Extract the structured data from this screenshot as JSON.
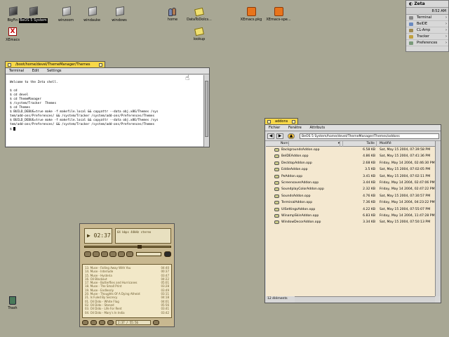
{
  "desktop": {
    "icons": [
      {
        "label": "BigFin",
        "kind": "cube-dark"
      },
      {
        "label": "BeOS 5 System",
        "kind": "cube-dark",
        "selected": true
      },
      {
        "label": "winzoom",
        "kind": "cube"
      },
      {
        "label": "windauke",
        "kind": "cube"
      },
      {
        "label": "windows",
        "kind": "cube"
      },
      {
        "label": "home",
        "kind": "people"
      },
      {
        "label": "DataToDoIcs...",
        "kind": "paper"
      },
      {
        "label": "XEmacs.pkg",
        "kind": "pkg"
      },
      {
        "label": "XEmacs-spe...",
        "kind": "pkg"
      },
      {
        "label": "XEmacs",
        "kind": "x"
      },
      {
        "label": "lookup",
        "kind": "paper"
      },
      {
        "label": "Trash",
        "kind": "trash"
      }
    ]
  },
  "deskbar": {
    "logo": "Zeta",
    "clock": "8:52 AM",
    "items": [
      {
        "label": "Terminal"
      },
      {
        "label": "BeIDE"
      },
      {
        "label": "CL-Amp"
      },
      {
        "label": "Tracker"
      },
      {
        "label": "Preferences"
      }
    ]
  },
  "terminal": {
    "title": "/boot/home/devel/ThemeManager/Themes",
    "menu": [
      "Terminal",
      "Edit",
      "Settings"
    ],
    "lines": [
      "",
      "Welcome to the Zeta shell.",
      "",
      "$ cd",
      "$ cd devel",
      "$ cd ThemeManager",
      "$ /system/Tracker  Themes",
      "$ cd Themes",
      "$ BUILD_DEBUG=true make -f makefile.local && copyattr --data obj.x86/Themes /sys",
      "tem/add-ons/Preferences/ && /system/Tracker /system/add-ons/Preferences/Themes",
      "$ BUILD_DEBUG=true make -f makefile.local && copyattr --data obj.x86/Themes /sys",
      "tem/add-ons/Preferences/ && /system/Tracker /system/add-ons/Preferences/Themes",
      "$ "
    ]
  },
  "addons": {
    "title": "addons",
    "menu": [
      "Fichier",
      "Fenêtre",
      "Attributs"
    ],
    "path": "BeOS 5 System/home/devel/ThemeManager/Themes/addons",
    "columns": {
      "name": "Nom",
      "size": "Taille",
      "modified": "Modifié"
    },
    "rows": [
      {
        "name": "BackgroundsAddon.opp",
        "size": "6.58 KB",
        "modified": "Sat, May 15 2004, 07:39:58 PM"
      },
      {
        "name": "BeIDEAddon.opp",
        "size": "4.86 KB",
        "modified": "Sat, May 15 2004, 07:41:36 PM"
      },
      {
        "name": "DecktopAddon.opp",
        "size": "2.68 KB",
        "modified": "Friday, May 14 2004, 02:46:30 PM"
      },
      {
        "name": "EddieAddon.opp",
        "size": "3.5 KB",
        "modified": "Sat, May 15 2004, 07:02:05 PM"
      },
      {
        "name": "PeAddon.opp",
        "size": "3.41 KB",
        "modified": "Sat, May 15 2004, 07:02:11 PM"
      },
      {
        "name": "ScreensaverAddon.opp",
        "size": "3.44 KB",
        "modified": "Friday, May 14 2004, 02:47:06 PM"
      },
      {
        "name": "SoundplayColorAddon.opp",
        "size": "2.32 KB",
        "modified": "Friday, May 14 2004, 02:47:22 PM"
      },
      {
        "name": "SoundsAddon.opp",
        "size": "4.76 KB",
        "modified": "Sat, May 15 2004, 07:30:57 PM"
      },
      {
        "name": "TerminalAddon.opp",
        "size": "7.36 KB",
        "modified": "Friday, May 14 2004, 04:23:22 PM"
      },
      {
        "name": "UISettingsAddon.opp",
        "size": "4.22 KB",
        "modified": "Sat, May 15 2004, 07:55:07 PM"
      },
      {
        "name": "WinampSkinAddon.opp",
        "size": "6.83 KB",
        "modified": "Friday, May 14 2004, 11:47:28 PM"
      },
      {
        "name": "WindowDecorAddon.opp",
        "size": "3.34 KB",
        "modified": "Sat, May 15 2004, 07:50:13 PM"
      }
    ],
    "status": "12 éléments"
  },
  "player": {
    "time": "02:37",
    "info": "64 kbps  44kHz  stereo",
    "playlist": [
      {
        "title": "13. Muse - Falling Away With You",
        "time": "04:40"
      },
      {
        "title": "14. Muse - Interlude",
        "time": "00:37"
      },
      {
        "title": "15. Muse - Hysteria",
        "time": "03:47"
      },
      {
        "title": "16. Oil Blackout",
        "time": "04:22"
      },
      {
        "title": "17. Muse - Butterflies and Hurricanes",
        "time": "05:01"
      },
      {
        "title": "18. Muse - The Small Print",
        "time": "03:28"
      },
      {
        "title": "19. Muse - Endlessly",
        "time": "03:49"
      },
      {
        "title": "20. Muse - Thoughts Of A Dying Atheist",
        "time": "03:11"
      },
      {
        "title": "21. Is Fuled By Secrecy",
        "time": "04:18"
      },
      {
        "title": "01. Oil Dido - White Flag",
        "time": "04:01"
      },
      {
        "title": "02. Oil Dido - Stoned",
        "time": "05:56"
      },
      {
        "title": "03. Oil Dido - Life For Rent",
        "time": "03:41"
      },
      {
        "title": "04. Oil Dido - Mary's In India",
        "time": "03:42"
      }
    ],
    "footer": "2:37 / 55:56"
  }
}
